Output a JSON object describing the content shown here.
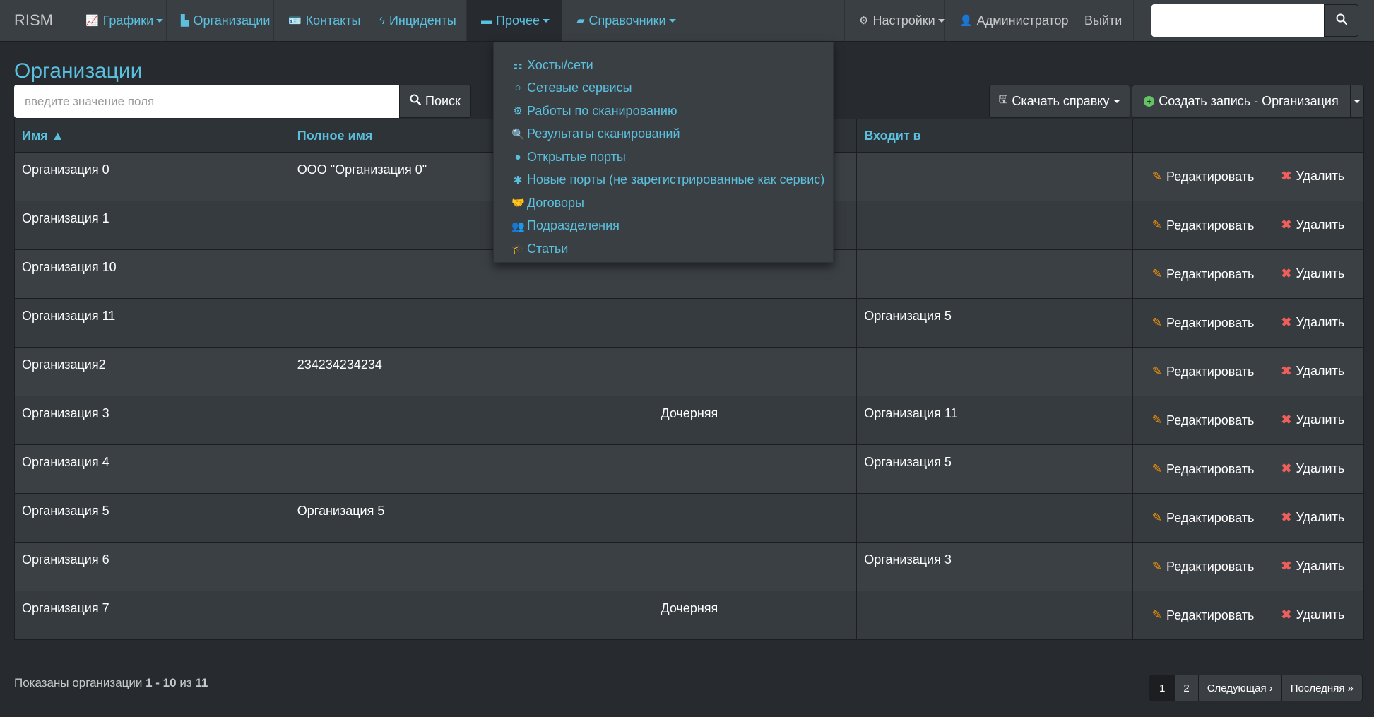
{
  "navbar": {
    "brand": "RISM",
    "items": [
      {
        "label": "Графики",
        "icon": "line-chart-icon",
        "glyph": "📈",
        "caret": true
      },
      {
        "label": "Организации",
        "icon": "bar-chart-icon",
        "glyph": "▙",
        "caret": false
      },
      {
        "label": "Контакты",
        "icon": "id-card-icon",
        "glyph": "🪪",
        "caret": false
      },
      {
        "label": "Инциденты",
        "icon": "bolt-icon",
        "glyph": "ϟ",
        "caret": false
      },
      {
        "label": "Прочее",
        "icon": "archive-icon",
        "glyph": "▬",
        "caret": true
      },
      {
        "label": "Справочники",
        "icon": "book-icon",
        "glyph": "▰",
        "caret": true
      }
    ],
    "settings_label": "Настройки",
    "user_label": "Администратор",
    "logout_label": "Выйти"
  },
  "page": {
    "title": "Организации",
    "search_placeholder": "введите значение поля",
    "search_button": "Поиск",
    "report_button": "Скачать справку",
    "create_button": "Создать запись - Организация"
  },
  "dropdown": {
    "items": [
      {
        "label": "Хосты/сети",
        "icon": "sitemap-icon",
        "glyph": "⚏"
      },
      {
        "label": "Сетевые сервисы",
        "icon": "circle-notch-icon",
        "glyph": "○"
      },
      {
        "label": "Работы по сканированию",
        "icon": "cogs-icon",
        "glyph": "⚙"
      },
      {
        "label": "Результаты сканирований",
        "icon": "search-icon",
        "glyph": "🔍"
      },
      {
        "label": "Открытые порты",
        "icon": "circle-icon",
        "glyph": "●"
      },
      {
        "label": "Новые порты (не зарегистрированные как сервис)",
        "icon": "asterisk-icon",
        "glyph": "✱"
      },
      {
        "label": "Договоры",
        "icon": "handshake-icon",
        "glyph": "🤝"
      },
      {
        "label": "Подразделения",
        "icon": "users-icon",
        "glyph": "👥"
      },
      {
        "label": "Статьи",
        "icon": "graduation-cap-icon",
        "glyph": "🎓"
      }
    ]
  },
  "table": {
    "columns": [
      "Имя ▲",
      "Полное имя",
      "",
      "Входит в",
      ""
    ],
    "edit_label": "Редактировать",
    "delete_label": "Удалить",
    "rows": [
      {
        "name": "Организация 0",
        "full_name": "ООО \"Организация 0\"",
        "type": "",
        "parent": ""
      },
      {
        "name": "Организация 1",
        "full_name": "",
        "type": "",
        "parent": ""
      },
      {
        "name": "Организация 10",
        "full_name": "",
        "type": "",
        "parent": ""
      },
      {
        "name": "Организация 11",
        "full_name": "",
        "type": "",
        "parent": "Организация 5"
      },
      {
        "name": "Организация2",
        "full_name": "234234234234",
        "type": "",
        "parent": ""
      },
      {
        "name": "Организация 3",
        "full_name": "",
        "type": "Дочерняя",
        "parent": "Организация 11"
      },
      {
        "name": "Организация 4",
        "full_name": "",
        "type": "",
        "parent": "Организация 5"
      },
      {
        "name": "Организация 5",
        "full_name": "Организация 5",
        "type": "",
        "parent": ""
      },
      {
        "name": "Организация 6",
        "full_name": "",
        "type": "",
        "parent": "Организация 3"
      },
      {
        "name": "Организация 7",
        "full_name": "",
        "type": "Дочерняя",
        "parent": ""
      }
    ]
  },
  "footer": {
    "summary_prefix": "Показаны организации",
    "range": "1 - 10",
    "of_label": "из",
    "total": "11",
    "pages": [
      "1",
      "2"
    ],
    "next_label": "Следующая ›",
    "last_label": "Последняя »"
  },
  "colors": {
    "accent": "#5bc0de",
    "background": "#272b30",
    "navbar": "#3a3f44",
    "edit_icon": "#f89406",
    "delete_icon": "#ee5f5b"
  }
}
